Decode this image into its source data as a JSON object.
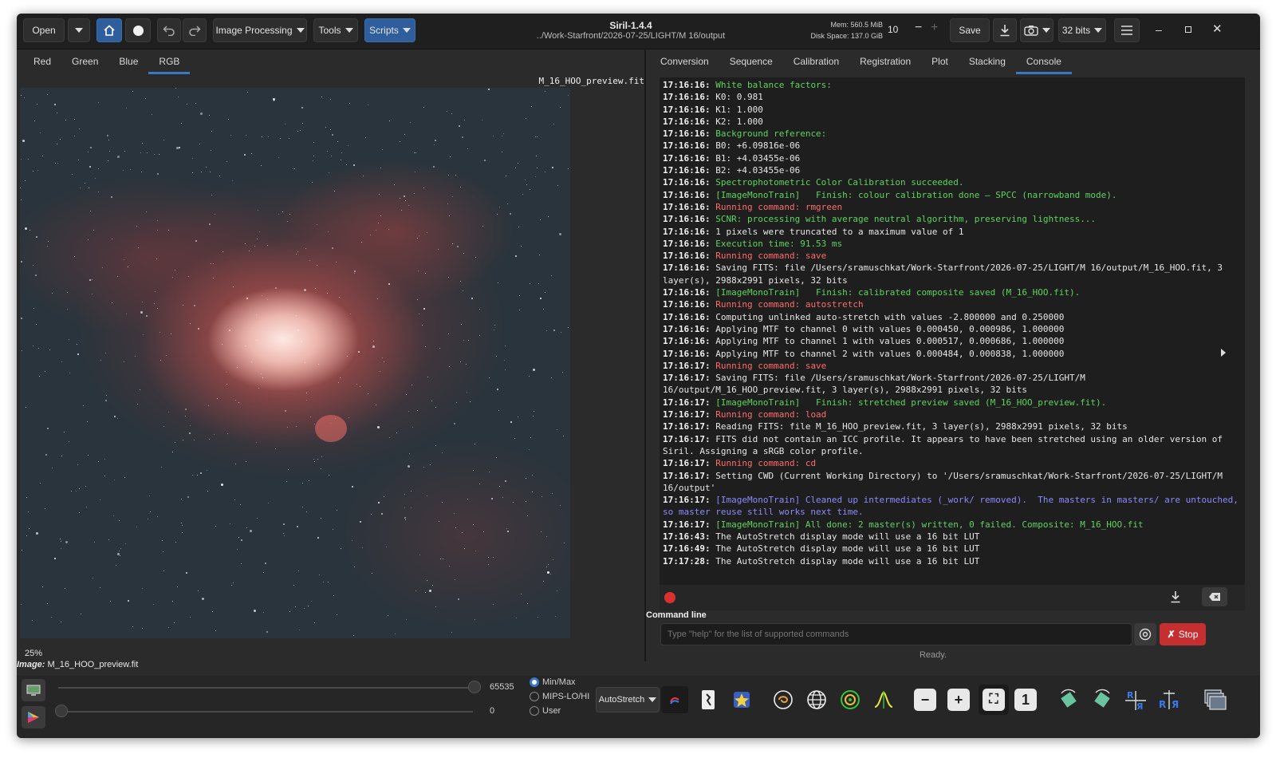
{
  "header": {
    "open_label": "Open",
    "image_processing": "Image Processing",
    "tools": "Tools",
    "scripts": "Scripts",
    "app_title": "Siril-1.4.4",
    "path": "../Work-Starfront/2026-07-25/LIGHT/M 16/output",
    "mem": "Mem: 560.5 MiB",
    "disk": "Disk Space: 137.0 GiB",
    "threads": "10",
    "save_label": "Save",
    "bits": "32 bits"
  },
  "channel_tabs": [
    "Red",
    "Green",
    "Blue",
    "RGB"
  ],
  "active_channel": "RGB",
  "panel_tabs": [
    "Conversion",
    "Sequence",
    "Calibration",
    "Registration",
    "Plot",
    "Stacking",
    "Console"
  ],
  "active_panel": "Console",
  "image": {
    "filename_tag": "M_16_HOO_preview.fit",
    "zoom": "25%",
    "image_label_prefix": "Image:",
    "image_label_name": "M_16_HOO_preview.fit"
  },
  "console_lines": [
    {
      "t": "17:16:16:",
      "m": "White balance factors:",
      "c": "g"
    },
    {
      "t": "17:16:16:",
      "m": "K0: 0.981",
      "c": "w"
    },
    {
      "t": "17:16:16:",
      "m": "K1: 1.000",
      "c": "w"
    },
    {
      "t": "17:16:16:",
      "m": "K2: 1.000",
      "c": "w"
    },
    {
      "t": "17:16:16:",
      "m": "Background reference:",
      "c": "g"
    },
    {
      "t": "17:16:16:",
      "m": "B0: +6.09816e-06",
      "c": "w"
    },
    {
      "t": "17:16:16:",
      "m": "B1: +4.03455e-06",
      "c": "w"
    },
    {
      "t": "17:16:16:",
      "m": "B2: +4.03455e-06",
      "c": "w"
    },
    {
      "t": "17:16:16:",
      "m": "Spectrophotometric Color Calibration succeeded.",
      "c": "g"
    },
    {
      "t": "17:16:16:",
      "m": "[ImageMonoTrain]   Finish: colour calibration done — SPCC (narrowband mode).",
      "c": "g"
    },
    {
      "t": "17:16:16:",
      "m": "Running command: rmgreen",
      "c": "r"
    },
    {
      "t": "17:16:16:",
      "m": "SCNR: processing with average neutral algorithm, preserving lightness...",
      "c": "g"
    },
    {
      "t": "17:16:16:",
      "m": "1 pixels were truncated to a maximum value of 1",
      "c": "w"
    },
    {
      "t": "17:16:16:",
      "m": "Execution time: 91.53 ms",
      "c": "g"
    },
    {
      "t": "17:16:16:",
      "m": "Running command: save",
      "c": "r"
    },
    {
      "t": "17:16:16:",
      "m": "Saving FITS: file /Users/sramuschkat/Work-Starfront/2026-07-25/LIGHT/M 16/output/M_16_HOO.fit, 3 layer(s), 2988x2991 pixels, 32 bits",
      "c": "w"
    },
    {
      "t": "17:16:16:",
      "m": "[ImageMonoTrain]   Finish: calibrated composite saved (M_16_HOO.fit).",
      "c": "g"
    },
    {
      "t": "17:16:16:",
      "m": "Running command: autostretch",
      "c": "r"
    },
    {
      "t": "17:16:16:",
      "m": "Computing unlinked auto-stretch with values -2.800000 and 0.250000",
      "c": "w"
    },
    {
      "t": "17:16:16:",
      "m": "Applying MTF to channel 0 with values 0.000450, 0.000986, 1.000000",
      "c": "w"
    },
    {
      "t": "17:16:16:",
      "m": "Applying MTF to channel 1 with values 0.000517, 0.000686, 1.000000",
      "c": "w"
    },
    {
      "t": "17:16:16:",
      "m": "Applying MTF to channel 2 with values 0.000484, 0.000838, 1.000000",
      "c": "w"
    },
    {
      "t": "17:16:17:",
      "m": "Running command: save",
      "c": "r"
    },
    {
      "t": "17:16:17:",
      "m": "Saving FITS: file /Users/sramuschkat/Work-Starfront/2026-07-25/LIGHT/M 16/output/M_16_HOO_preview.fit, 3 layer(s), 2988x2991 pixels, 32 bits",
      "c": "w"
    },
    {
      "t": "17:16:17:",
      "m": "[ImageMonoTrain]   Finish: stretched preview saved (M_16_HOO_preview.fit).",
      "c": "g"
    },
    {
      "t": "17:16:17:",
      "m": "Running command: load",
      "c": "r"
    },
    {
      "t": "17:16:17:",
      "m": "Reading FITS: file M_16_HOO_preview.fit, 3 layer(s), 2988x2991 pixels, 32 bits",
      "c": "w"
    },
    {
      "t": "17:16:17:",
      "m": "FITS did not contain an ICC profile. It appears to have been stretched using an older version of Siril. Assigning a sRGB color profile.",
      "c": "w"
    },
    {
      "t": "17:16:17:",
      "m": "Running command: cd",
      "c": "r"
    },
    {
      "t": "17:16:17:",
      "m": "Setting CWD (Current Working Directory) to '/Users/sramuschkat/Work-Starfront/2026-07-25/LIGHT/M 16/output'",
      "c": "w"
    },
    {
      "t": "17:16:17:",
      "m": "[ImageMonoTrain] Cleaned up intermediates (_work/ removed).  The masters in masters/ are untouched, so master reuse still works next time.",
      "c": "b"
    },
    {
      "t": "17:16:17:",
      "m": "[ImageMonoTrain] All done: 2 master(s) written, 0 failed. Composite: M_16_HOO.fit",
      "c": "g"
    },
    {
      "t": "17:16:43:",
      "m": "The AutoStretch display mode will use a 16 bit LUT",
      "c": "w"
    },
    {
      "t": "17:16:49:",
      "m": "The AutoStretch display mode will use a 16 bit LUT",
      "c": "w"
    },
    {
      "t": "17:17:28:",
      "m": "The AutoStretch display mode will use a 16 bit LUT",
      "c": "w"
    }
  ],
  "command": {
    "section_label": "Command line",
    "placeholder": "Type \"help\" for the list of supported commands",
    "stop_label": "Stop",
    "status": "Ready."
  },
  "sliders": {
    "hi_value": "65535",
    "lo_value": "0",
    "modes": [
      "Min/Max",
      "MIPS-LO/HI",
      "User"
    ],
    "selected_mode": "Min/Max",
    "stretch_select": "AutoStretch"
  },
  "colors": {
    "accent": "#3a78c4",
    "stop_red": "#c62f2f",
    "log_green": "#5fd35f",
    "log_red": "#ff6b6b",
    "log_blue": "#8a8aff"
  }
}
